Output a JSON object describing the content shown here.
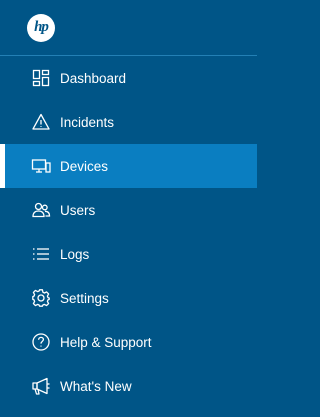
{
  "logo": {
    "text": "hp"
  },
  "nav": {
    "active_index": 2,
    "items": [
      {
        "label": "Dashboard",
        "icon": "dashboard-icon"
      },
      {
        "label": "Incidents",
        "icon": "warning-icon"
      },
      {
        "label": "Devices",
        "icon": "devices-icon"
      },
      {
        "label": "Users",
        "icon": "users-icon"
      },
      {
        "label": "Logs",
        "icon": "list-icon"
      },
      {
        "label": "Settings",
        "icon": "gear-icon"
      },
      {
        "label": "Help & Support",
        "icon": "help-icon"
      },
      {
        "label": "What's New",
        "icon": "megaphone-icon"
      }
    ]
  },
  "colors": {
    "background": "#005587",
    "active_background": "#0a7ec1",
    "active_indicator": "#ffffff",
    "text": "#ffffff"
  }
}
